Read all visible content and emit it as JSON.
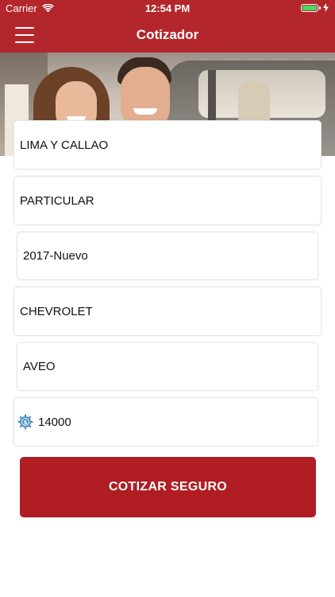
{
  "status_bar": {
    "carrier": "Carrier",
    "time": "12:54 PM"
  },
  "nav": {
    "title": "Cotizador",
    "menu_icon": "hamburger-menu-icon"
  },
  "form": {
    "region": "LIMA Y CALLAO",
    "usage": "PARTICULAR",
    "year": "2017-Nuevo",
    "brand": "CHEVROLET",
    "model": "AVEO",
    "price": "14000",
    "price_icon": "dollar-gear-icon"
  },
  "cta_label": "COTIZAR SEGURO",
  "colors": {
    "brand_red": "#b3272c",
    "button_red": "#b01e24",
    "battery_green": "#4cd964"
  }
}
